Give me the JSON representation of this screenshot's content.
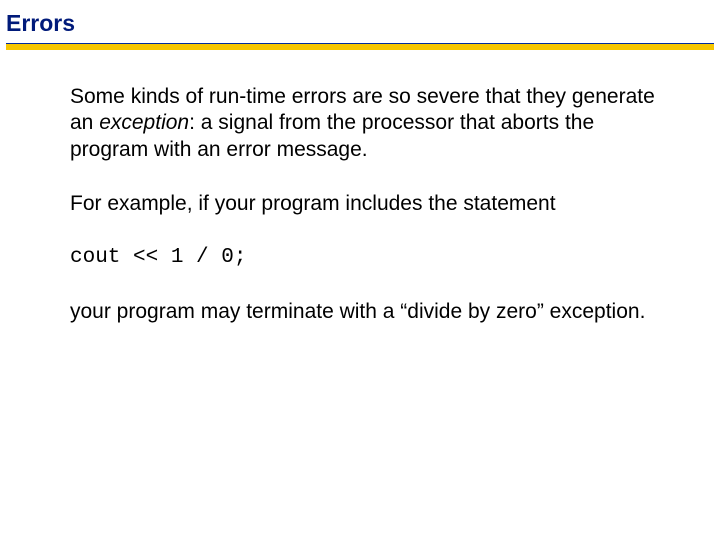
{
  "title": "Errors",
  "para1_a": "Some kinds of run-time errors are so severe that they generate an ",
  "para1_em": "exception",
  "para1_b": ": a signal from the processor that aborts the program with an error message.",
  "para2": "For example, if your program includes the statement",
  "code": "cout << 1 / 0;",
  "para3": "your program may terminate with a “divide by zero” exception."
}
